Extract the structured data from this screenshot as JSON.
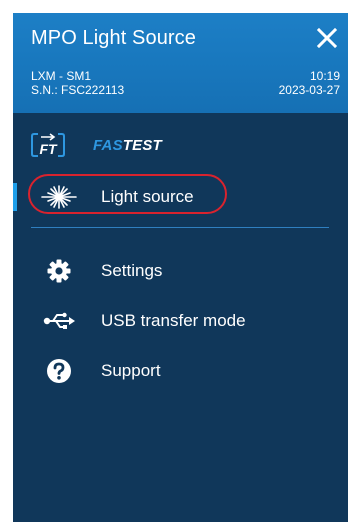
{
  "header": {
    "title": "MPO Light Source",
    "device_model": "LXM - SM1",
    "serial": "S.N.: FSC222113",
    "time": "10:19",
    "date": "2023-03-27"
  },
  "brand": {
    "logo_text": "FT",
    "name_part1": "FAS",
    "name_part2": "TEST"
  },
  "menu": {
    "items": [
      {
        "label": "Light source",
        "icon": "laser-burst-icon",
        "active": true
      },
      {
        "label": "Settings",
        "icon": "gear-icon"
      },
      {
        "label": "USB transfer mode",
        "icon": "usb-icon"
      },
      {
        "label": "Support",
        "icon": "help-icon"
      }
    ]
  },
  "colors": {
    "panel": "#10375a",
    "header": "#1877bd",
    "accent": "#1ea0ec",
    "highlight": "#d9232e"
  }
}
